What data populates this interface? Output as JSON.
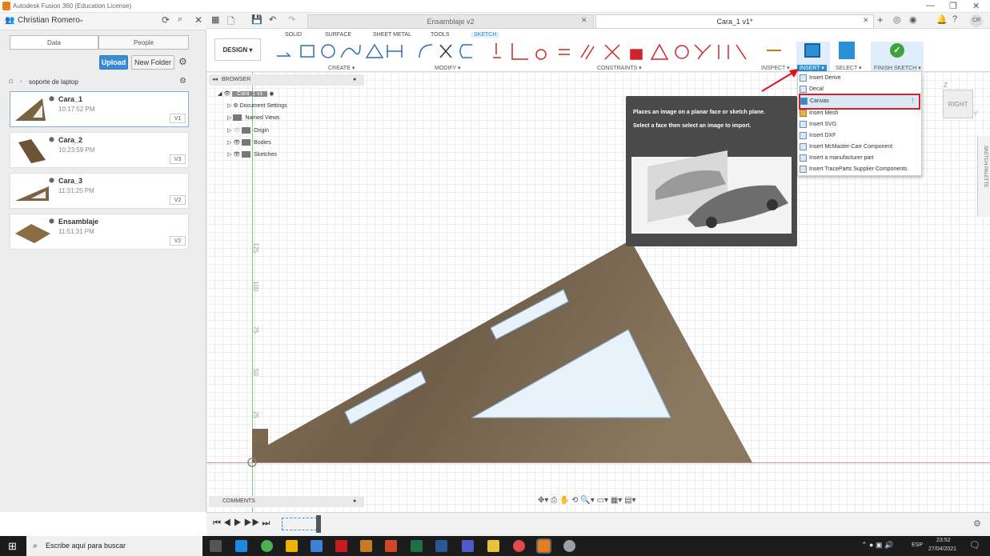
{
  "window": {
    "title": "Autodesk Fusion 360 (Education License)"
  },
  "data_panel": {
    "user": "Christian Romero",
    "tabs": [
      "Data",
      "People"
    ],
    "upload": "Upload",
    "new_folder": "New Folder",
    "project": "soporte de laptop",
    "files": [
      {
        "name": "Cara_1",
        "time": "10:17:52 PM",
        "version": "V1"
      },
      {
        "name": "Cara_2",
        "time": "10:23:59 PM",
        "version": "V3"
      },
      {
        "name": "Cara_3",
        "time": "11:31:25 PM",
        "version": "V2"
      },
      {
        "name": "Ensamblaje",
        "time": "11:51:31 PM",
        "version": "V2"
      }
    ]
  },
  "doc_tabs": [
    "Ensamblaje v2",
    "Cara_1 v1*"
  ],
  "toolbar": {
    "workspace": "DESIGN",
    "tabs": [
      "SOLID",
      "SURFACE",
      "SHEET METAL",
      "TOOLS",
      "SKETCH"
    ],
    "groups": [
      "CREATE",
      "MODIFY",
      "CONSTRAINTS",
      "INSPECT",
      "INSERT",
      "SELECT",
      "FINISH SKETCH"
    ]
  },
  "browser": {
    "header": "BROWSER",
    "root": "Cara_1 v1",
    "nodes": [
      "Document Settings",
      "Named Views",
      "Origin",
      "Bodies",
      "Sketches"
    ],
    "comments": "COMMENTS"
  },
  "tooltip": {
    "line1": "Places an image on a planar face or sketch plane.",
    "line2": "Select a face then select an image to import."
  },
  "insert_menu": {
    "items": [
      "Insert Derive",
      "Decal",
      "Canvas",
      "Insert Mesh",
      "Insert SVG",
      "Insert DXF",
      "Insert McMaster-Carr Component",
      "Insert a manufacturer part",
      "Insert TraceParts Supplier Components"
    ],
    "highlighted": "Canvas"
  },
  "viewcube": {
    "face": "RIGHT",
    "axis_z": "Z",
    "axis_y": "Y"
  },
  "sketch_palette": "SKETCH PALETTE",
  "ruler": [
    "125",
    "100",
    "75",
    "50",
    "25"
  ],
  "taskbar": {
    "search": "Escribe aquí para buscar",
    "lang": "ESP",
    "time": "23:52",
    "date": "27/04/2021"
  },
  "colors": {
    "accent": "#2b8fd6",
    "highlight_border": "#d1242a",
    "wood": "#7a6a55"
  }
}
